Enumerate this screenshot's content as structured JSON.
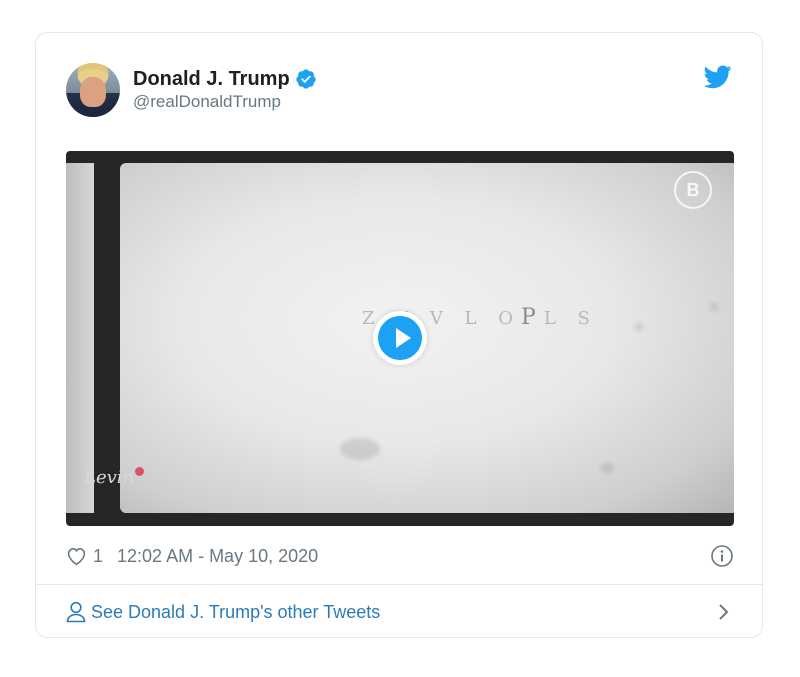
{
  "tweet": {
    "author": {
      "display_name": "Donald J. Trump",
      "handle": "@realDonaldTrump",
      "verified": true
    },
    "media": {
      "type": "video",
      "overlay_text_small": "Z Y V L O",
      "overlay_text_big": "P",
      "overlay_text_tail": "L S",
      "badge": "B",
      "signature": "Levin"
    },
    "likes": "1",
    "timestamp": "12:02 AM - May 10, 2020",
    "footer_link": "See Donald J. Trump's other Tweets"
  },
  "colors": {
    "accent": "#1da1f2",
    "link": "#2b7bb9",
    "muted": "#697882",
    "border": "#e1e8ed"
  },
  "icons": {
    "verified": "verified-badge-icon",
    "brand": "twitter-bird-icon",
    "play": "play-icon",
    "like": "heart-icon",
    "info": "info-icon",
    "profile": "person-icon",
    "next": "chevron-right-icon"
  }
}
